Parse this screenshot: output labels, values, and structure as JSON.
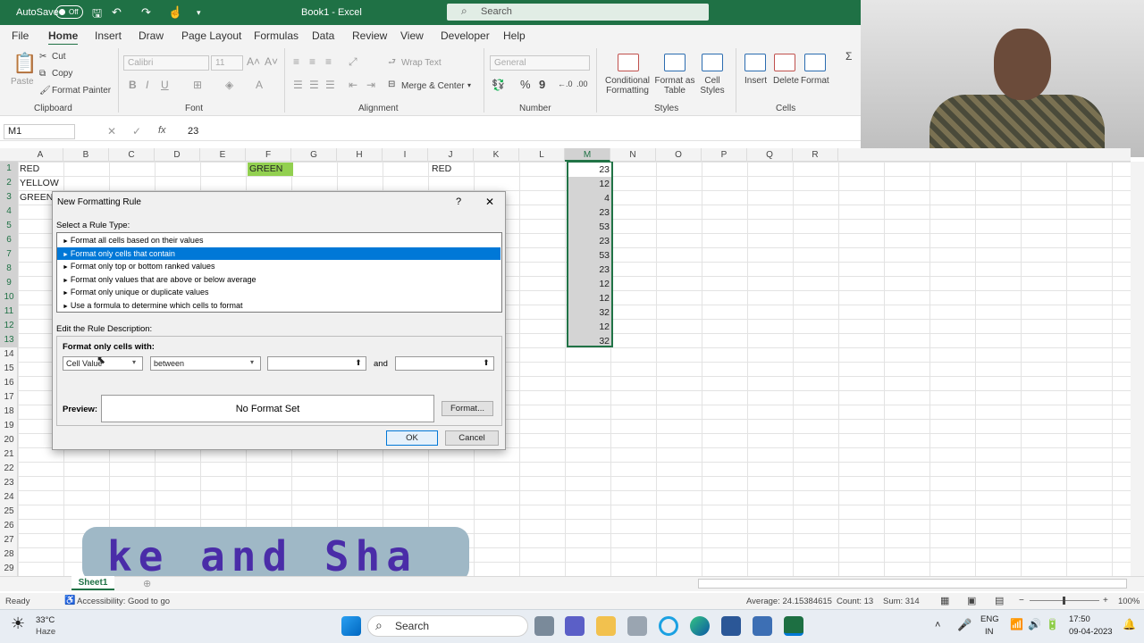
{
  "titlebar": {
    "autosave": "AutoSave",
    "autosave_state": "Off",
    "title": "Book1 - Excel",
    "search_placeholder": "Search"
  },
  "menu": [
    "File",
    "Home",
    "Insert",
    "Draw",
    "Page Layout",
    "Formulas",
    "Data",
    "Review",
    "View",
    "Developer",
    "Help"
  ],
  "ribbon": {
    "paste": "Paste",
    "cut": "Cut",
    "copy": "Copy",
    "format_painter": "Format Painter",
    "clipboard": "Clipboard",
    "font_name": "Calibri",
    "font_size": "11",
    "font": "Font",
    "wrap_text": "Wrap Text",
    "merge_center": "Merge & Center",
    "alignment": "Alignment",
    "number_format": "General",
    "number": "Number",
    "conditional_formatting": "Conditional Formatting",
    "format_as_table": "Format as Table",
    "cell_styles": "Cell Styles",
    "styles": "Styles",
    "insert": "Insert",
    "delete": "Delete",
    "format": "Format",
    "cells": "Cells"
  },
  "formula_bar": {
    "name_box": "M1",
    "fx": "fx",
    "value": "23"
  },
  "columns": [
    "A",
    "B",
    "C",
    "D",
    "E",
    "F",
    "G",
    "H",
    "I",
    "J",
    "K",
    "L",
    "M",
    "N",
    "O",
    "P",
    "Q",
    "R"
  ],
  "rows": [
    "1",
    "2",
    "3",
    "4",
    "5",
    "6",
    "7",
    "8",
    "9",
    "10",
    "11",
    "12",
    "13",
    "14",
    "15",
    "16",
    "17",
    "18",
    "19",
    "20",
    "21",
    "22",
    "23",
    "24",
    "25",
    "26",
    "27",
    "28",
    "29"
  ],
  "cells": {
    "A1": "RED",
    "A2": "YELLOW",
    "A3": "GREEN",
    "F1": "GREEN",
    "J1": "RED"
  },
  "colors": {
    "excel_green": "#1f7145",
    "f1_fill": "#92d050",
    "selection": "#0078d7"
  },
  "m_values": [
    "23",
    "12",
    "4",
    "23",
    "53",
    "23",
    "53",
    "23",
    "12",
    "12",
    "32",
    "12",
    "32"
  ],
  "dialog": {
    "title": "New Formatting Rule",
    "help": "?",
    "close": "✕",
    "select_rule_type": "Select a Rule Type:",
    "rule_types": [
      "Format all cells based on their values",
      "Format only cells that contain",
      "Format only top or bottom ranked values",
      "Format only values that are above or below average",
      "Format only unique or duplicate values",
      "Use a formula to determine which cells to format"
    ],
    "selected_rule": 1,
    "edit_description": "Edit the Rule Description:",
    "format_only_cells_with": "Format only cells with:",
    "condition1": "Cell Value",
    "condition2": "between",
    "value1": "",
    "and": "and",
    "value2": "",
    "preview_label": "Preview:",
    "preview_text": "No Format Set",
    "format_button": "Format...",
    "ok": "OK",
    "cancel": "Cancel"
  },
  "banner_text": "ke and Sha",
  "sheet_tab": "Sheet1",
  "status": {
    "ready": "Ready",
    "accessibility": "Accessibility: Good to go",
    "average": "Average: 24.15384615",
    "count": "Count: 13",
    "sum": "Sum: 314",
    "zoom": "100%"
  },
  "taskbar": {
    "temp": "33°C",
    "weather": "Haze",
    "search": "Search",
    "lang": "ENG",
    "region": "IN",
    "time": "17:50",
    "date": "09-04-2023"
  }
}
